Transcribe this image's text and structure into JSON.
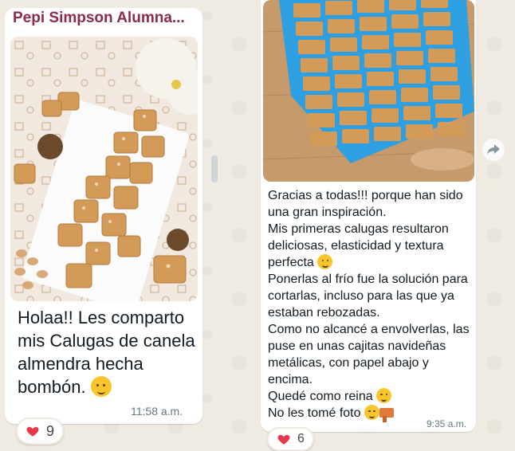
{
  "left_message": {
    "sender": "Pepi Simpson Alumna...",
    "text": "Holaa!! Les comparto mis Calugas de canela almendra hecha bombón.",
    "time": "11:58 a.m.",
    "reaction_count": "9",
    "reaction_icon": "red-heart"
  },
  "right_message": {
    "lines": [
      "Gracias a todas!!! porque han sido una gran inspiración.",
      "Mis primeras calugas resultaron deliciosas, elasticidad y textura perfecta",
      "Ponerlas al frío fue la solución para cortarlas, incluso para las que ya estaban rebozadas.",
      "Como no alcancé a envolverlas, las puse en unas cajitas navideñas metálicas, con papel abajo y encima.",
      "Quedé como reina",
      "No les tomé foto"
    ],
    "time": "9:35 a.m.",
    "reaction_count": "6",
    "reaction_icon": "red-heart"
  },
  "colors": {
    "chat_background": "#efeae2",
    "sender_name": "#8a2a4f",
    "mold_blue": "#2e9fe0",
    "caramel": "#d49a58"
  }
}
